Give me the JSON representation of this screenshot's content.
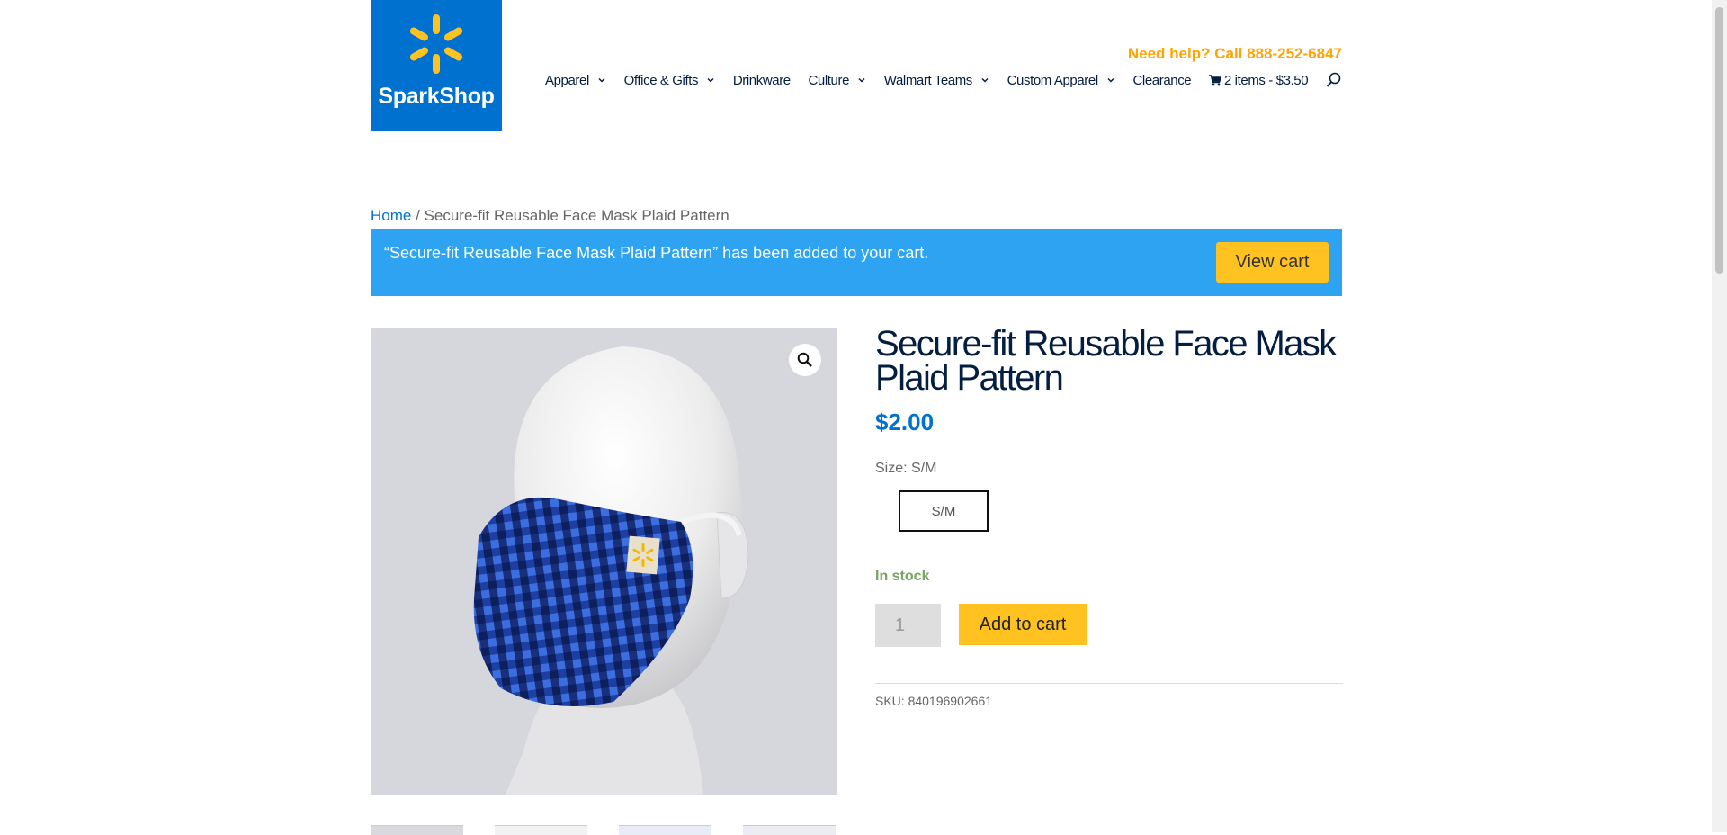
{
  "brand": {
    "name": "SparkShop",
    "color": "#0071ce",
    "accent": "#ffc220"
  },
  "header": {
    "help_text": "Need help? Call 888-252-6847",
    "nav": [
      {
        "label": "Apparel",
        "dropdown": true
      },
      {
        "label": "Office & Gifts",
        "dropdown": true
      },
      {
        "label": "Drinkware",
        "dropdown": false
      },
      {
        "label": "Culture",
        "dropdown": true
      },
      {
        "label": "Walmart Teams",
        "dropdown": true
      },
      {
        "label": "Custom Apparel",
        "dropdown": true
      },
      {
        "label": "Clearance",
        "dropdown": false
      }
    ],
    "cart_label": "2 items - $3.50",
    "icons": [
      "spark-logo-icon",
      "chevron-down-icon",
      "cart-icon",
      "search-icon"
    ]
  },
  "breadcrumb": {
    "home": "Home",
    "separator": " / ",
    "current": "Secure-fit Reusable Face Mask Plaid Pattern"
  },
  "notice": {
    "message": "“Secure-fit Reusable Face Mask Plaid Pattern” has been added to your cart.",
    "button": "View cart"
  },
  "product": {
    "title": "Secure-fit Reusable Face Mask Plaid Pattern",
    "price": "$2.00",
    "size_label": "Size: S/M",
    "size_option": "S/M",
    "stock": "In stock",
    "quantity": "1",
    "add_to_cart": "Add to cart",
    "sku_label": "SKU:",
    "sku_value": "840196902661",
    "image_icons": [
      "zoom-icon"
    ]
  }
}
